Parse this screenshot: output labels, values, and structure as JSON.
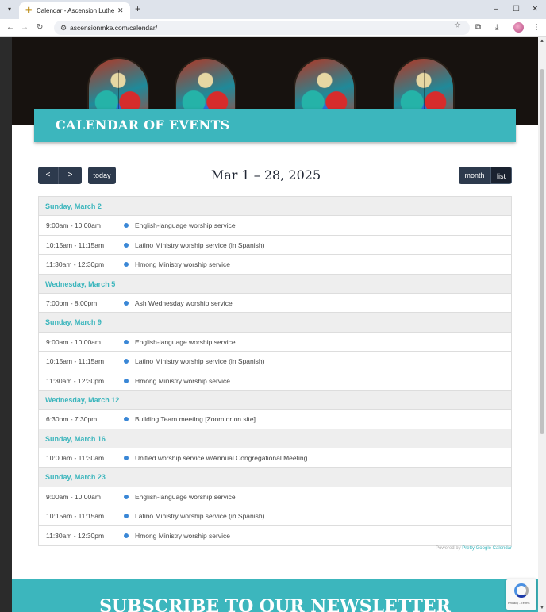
{
  "browser": {
    "tab_title": "Calendar - Ascension Lutheran",
    "tab_close": "✕",
    "new_tab": "+",
    "url": "ascensionmke.com/calendar/",
    "minimize": "–",
    "maximize": "☐",
    "close": "✕"
  },
  "banner": {
    "title": "CALENDAR OF EVENTS"
  },
  "toolbar": {
    "prev": "<",
    "next": ">",
    "today": "today",
    "range": "Mar 1 – 28, 2025",
    "month": "month",
    "list": "list"
  },
  "colors": {
    "accent": "#3cb6bd",
    "button": "#2d3a4d",
    "dot": "#3a87d6"
  },
  "days": [
    {
      "label": "Sunday, March 2",
      "events": [
        {
          "time": "9:00am - 10:00am",
          "title": "English-language worship service"
        },
        {
          "time": "10:15am - 11:15am",
          "title": "Latino Ministry worship service (in Spanish)"
        },
        {
          "time": "11:30am - 12:30pm",
          "title": "Hmong Ministry worship service"
        }
      ]
    },
    {
      "label": "Wednesday, March 5",
      "events": [
        {
          "time": "7:00pm - 8:00pm",
          "title": "Ash Wednesday worship service"
        }
      ]
    },
    {
      "label": "Sunday, March 9",
      "events": [
        {
          "time": "9:00am - 10:00am",
          "title": "English-language worship service"
        },
        {
          "time": "10:15am - 11:15am",
          "title": "Latino Ministry worship service (in Spanish)"
        },
        {
          "time": "11:30am - 12:30pm",
          "title": "Hmong Ministry worship service"
        }
      ]
    },
    {
      "label": "Wednesday, March 12",
      "events": [
        {
          "time": "6:30pm - 7:30pm",
          "title": "Building Team meeting [Zoom or on site]"
        }
      ]
    },
    {
      "label": "Sunday, March 16",
      "events": [
        {
          "time": "10:00am - 11:30am",
          "title": "Unified worship service w/Annual Congregational Meeting"
        }
      ]
    },
    {
      "label": "Sunday, March 23",
      "events": [
        {
          "time": "9:00am - 10:00am",
          "title": "English-language worship service"
        },
        {
          "time": "10:15am - 11:15am",
          "title": "Latino Ministry worship service (in Spanish)"
        },
        {
          "time": "11:30am - 12:30pm",
          "title": "Hmong Ministry worship service"
        }
      ]
    }
  ],
  "powered_by": {
    "prefix": "Powered by ",
    "link": "Pretty Google Calendar"
  },
  "newsletter": {
    "title": "SUBSCRIBE TO OUR NEWSLETTER"
  },
  "recaptcha": {
    "label": "Privacy - Terms"
  }
}
